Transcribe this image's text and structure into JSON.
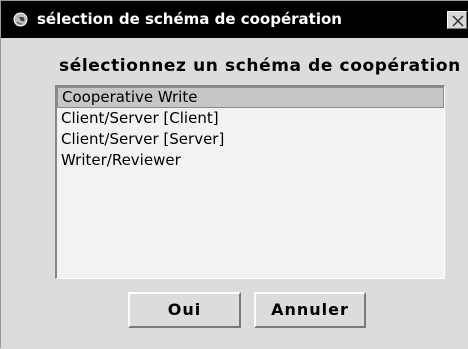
{
  "window": {
    "title": "sélection de schéma de coopération",
    "title_icon": "globe-icon",
    "close_icon": "close-icon"
  },
  "main": {
    "heading": "sélectionnez un schéma de coopération",
    "list": {
      "items": [
        {
          "label": "Cooperative Write",
          "selected": true
        },
        {
          "label": "Client/Server [Client]",
          "selected": false
        },
        {
          "label": "Client/Server [Server]",
          "selected": false
        },
        {
          "label": "Writer/Reviewer",
          "selected": false
        }
      ]
    }
  },
  "buttons": {
    "ok_label": "Oui",
    "cancel_label": "Annuler"
  }
}
